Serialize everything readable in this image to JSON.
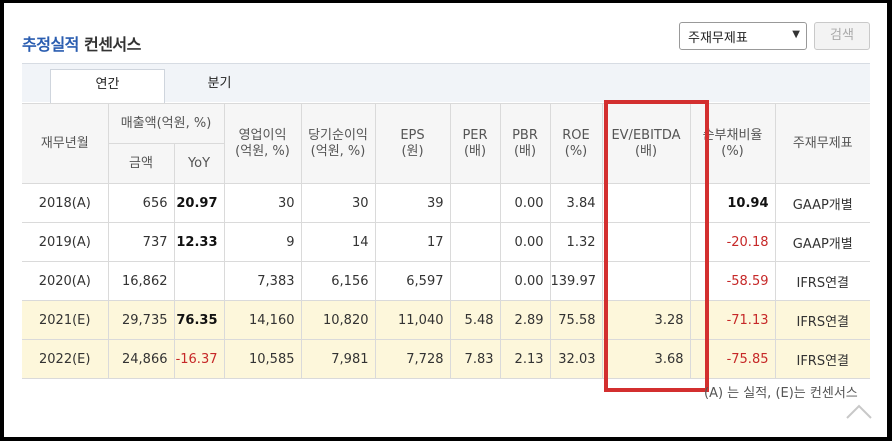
{
  "header": {
    "title_part1": "추정실적",
    "title_part2": "컨센서스"
  },
  "controls": {
    "select_value": "주재무제표",
    "search_label": "검색"
  },
  "tabs": [
    {
      "label": "연간",
      "active": true
    },
    {
      "label": "분기",
      "active": false
    }
  ],
  "table": {
    "headers": {
      "period": "재무년월",
      "sales_group": "매출액(억원, %)",
      "sales_amount": "금액",
      "sales_yoy": "YoY",
      "op_income_1": "영업이익",
      "op_income_2": "(억원, %)",
      "net_income_1": "당기순이익",
      "net_income_2": "(억원, %)",
      "eps_1": "EPS",
      "eps_2": "(원)",
      "per_1": "PER",
      "per_2": "(배)",
      "pbr_1": "PBR",
      "pbr_2": "(배)",
      "roe_1": "ROE",
      "roe_2": "(%)",
      "ev_1": "EV/EBITDA",
      "ev_2": "(배)",
      "debt_1": "순부채비율",
      "debt_2": "(%)",
      "basis": "주재무제표"
    },
    "rows": [
      {
        "period": "2018(A)",
        "sales": "656",
        "yoy": "20.97",
        "op": "30",
        "net": "30",
        "eps": "39",
        "per": "",
        "pbr": "0.00",
        "roe": "3.84",
        "ev": "",
        "debt": "10.94",
        "basis": "GAAP개별",
        "yoy_style": "bold",
        "debt_style": "bold",
        "highlight": false
      },
      {
        "period": "2019(A)",
        "sales": "737",
        "yoy": "12.33",
        "op": "9",
        "net": "14",
        "eps": "17",
        "per": "",
        "pbr": "0.00",
        "roe": "1.32",
        "ev": "",
        "debt": "-20.18",
        "basis": "GAAP개별",
        "yoy_style": "bold",
        "debt_style": "red",
        "highlight": false
      },
      {
        "period": "2020(A)",
        "sales": "16,862",
        "yoy": "",
        "op": "7,383",
        "net": "6,156",
        "eps": "6,597",
        "per": "",
        "pbr": "0.00",
        "roe": "139.97",
        "ev": "",
        "debt": "-58.59",
        "basis": "IFRS연결",
        "yoy_style": "",
        "debt_style": "red",
        "highlight": false
      },
      {
        "period": "2021(E)",
        "sales": "29,735",
        "yoy": "76.35",
        "op": "14,160",
        "net": "10,820",
        "eps": "11,040",
        "per": "5.48",
        "pbr": "2.89",
        "roe": "75.58",
        "ev": "3.28",
        "debt": "-71.13",
        "basis": "IFRS연결",
        "yoy_style": "bold",
        "debt_style": "red",
        "highlight": true
      },
      {
        "period": "2022(E)",
        "sales": "24,866",
        "yoy": "-16.37",
        "op": "10,585",
        "net": "7,981",
        "eps": "7,728",
        "per": "7.83",
        "pbr": "2.13",
        "roe": "32.03",
        "ev": "3.68",
        "debt": "-75.85",
        "basis": "IFRS연결",
        "yoy_style": "red",
        "debt_style": "red",
        "highlight": true
      }
    ]
  },
  "footnote": "(A) 는 실적, (E)는 컨센서스",
  "colors": {
    "highlight_box": "#d32f2f",
    "negative": "#c62828",
    "estimate_row": "#fdf7db",
    "title_blue": "#2a5db0"
  },
  "icons": {
    "select": "chevron-down-icon",
    "scroll": "chevron-up-icon"
  }
}
